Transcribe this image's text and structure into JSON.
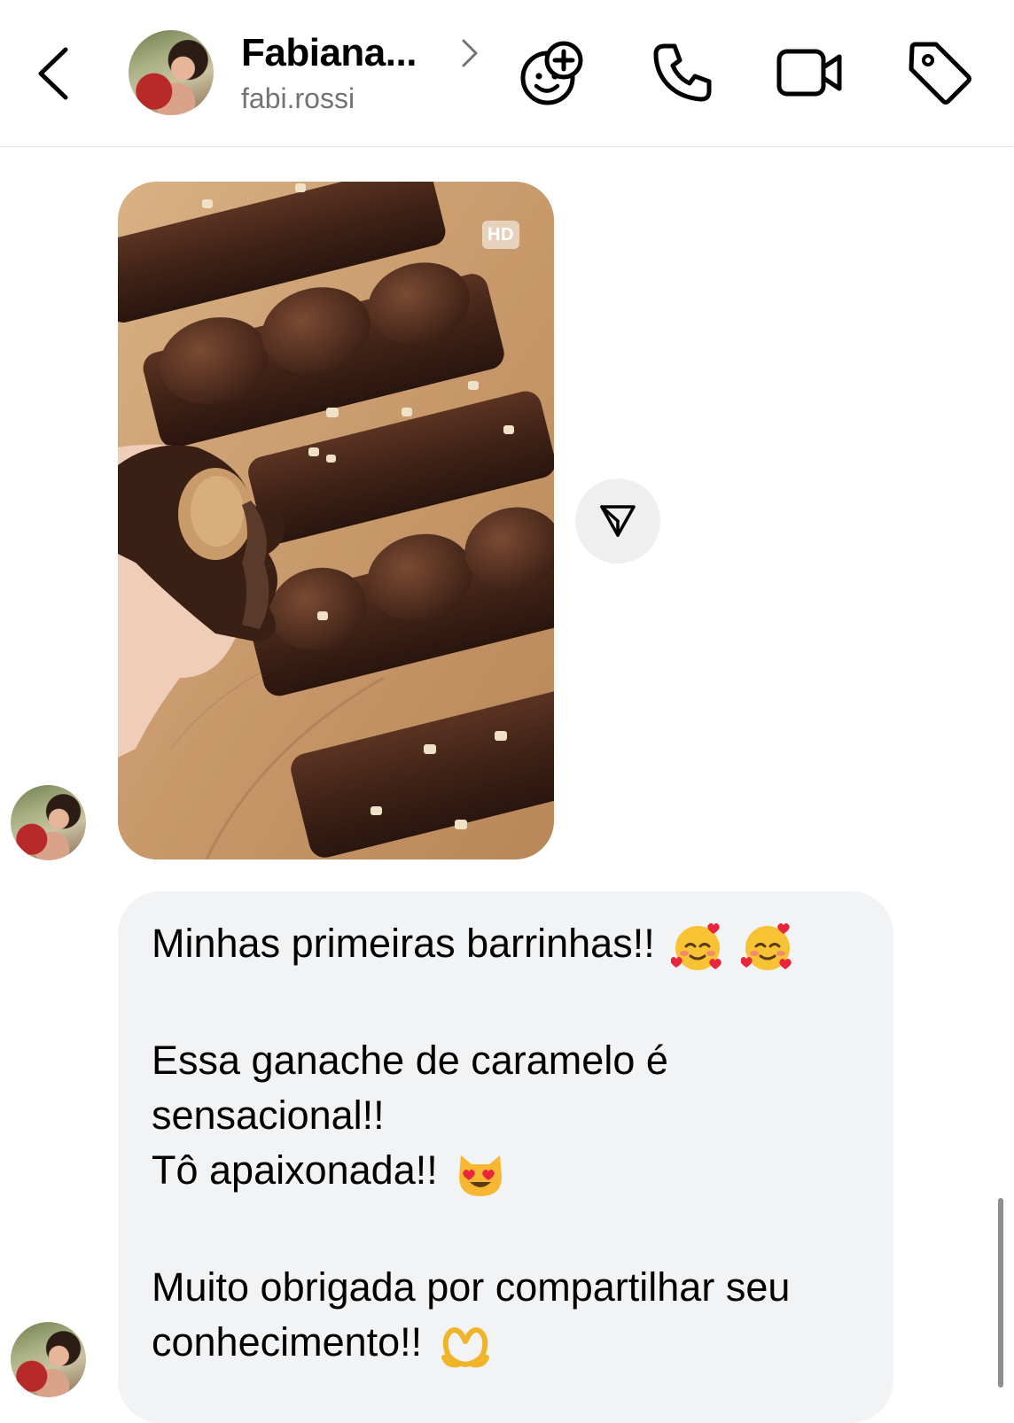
{
  "header": {
    "name": "Fabiana...",
    "username": "fabi.rossi"
  },
  "media": {
    "quality_badge": "HD"
  },
  "message": {
    "line1": "Minhas primeiras barrinhas!!",
    "line2": "Essa ganache de caramelo é",
    "line3": "sensacional!!",
    "line4": "Tô apaixonada!!",
    "line5": "Muito obrigada por compartilhar seu",
    "line6": "conhecimento!!"
  },
  "icons": {
    "back": "chevron-left-icon",
    "effects": "smiley-plus-icon",
    "call": "phone-icon",
    "video": "video-camera-icon",
    "label": "tag-icon",
    "share": "paper-plane-icon"
  },
  "colors": {
    "bubble": "#f2f3f5",
    "secondary_text": "#737373"
  }
}
